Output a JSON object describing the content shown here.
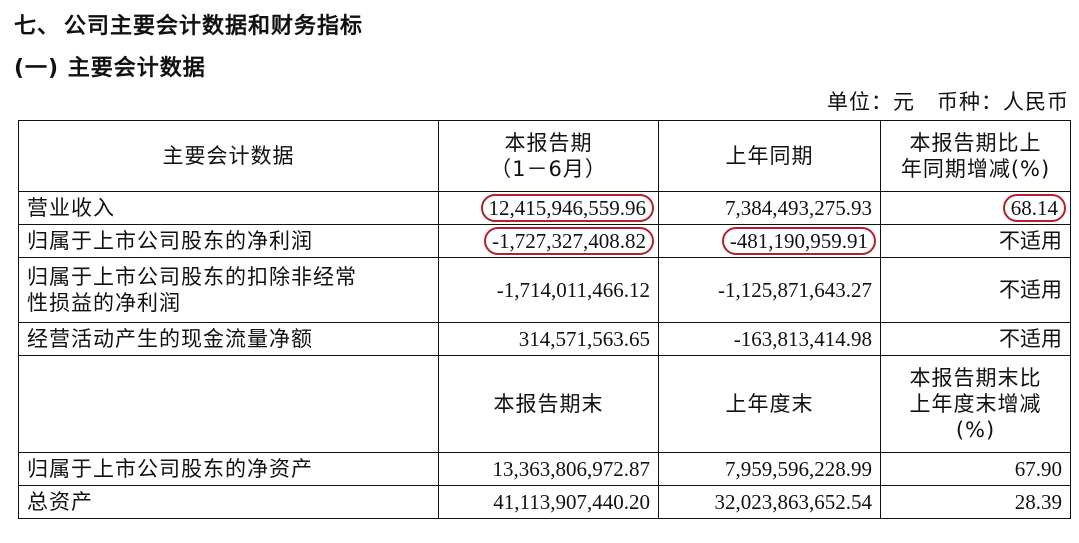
{
  "section": {
    "number": "七、",
    "title": "公司主要会计数据和财务指标"
  },
  "subsection": {
    "title": "(一) 主要会计数据"
  },
  "unit_line": {
    "unit": "单位：元",
    "currency": "币种：人民币"
  },
  "table": {
    "header1": {
      "col1": "主要会计数据",
      "col2_line1": "本报告期",
      "col2_line2": "（1－6月）",
      "col3": "上年同期",
      "col4_line1": "本报告期比上",
      "col4_line2": "年同期增减(%)"
    },
    "rows1": [
      {
        "label": "营业收入",
        "current": "12,415,946,559.96",
        "prior": "7,384,493,275.93",
        "change": "68.14"
      },
      {
        "label": "归属于上市公司股东的净利润",
        "current": "-1,727,327,408.82",
        "prior": "-481,190,959.91",
        "change": "不适用"
      },
      {
        "label_line1": "归属于上市公司股东的扣除非经常",
        "label_line2": "性损益的净利润",
        "current": "-1,714,011,466.12",
        "prior": "-1,125,871,643.27",
        "change": "不适用"
      },
      {
        "label": "经营活动产生的现金流量净额",
        "current": "314,571,563.65",
        "prior": "-163,813,414.98",
        "change": "不适用"
      }
    ],
    "header2": {
      "col1": "",
      "col2": "本报告期末",
      "col3": "上年度末",
      "col4_line1": "本报告期末比",
      "col4_line2": "上年度末增减",
      "col4_line3": "(%)"
    },
    "rows2": [
      {
        "label": "归属于上市公司股东的净资产",
        "current": "13,363,806,972.87",
        "prior": "7,959,596,228.99",
        "change": "67.90"
      },
      {
        "label": "总资产",
        "current": "41,113,907,440.20",
        "prior": "32,023,863,652.54",
        "change": "28.39"
      }
    ]
  },
  "colors": {
    "annotation_circle": "#b3202a",
    "text": "#111111",
    "border": "#111111"
  }
}
